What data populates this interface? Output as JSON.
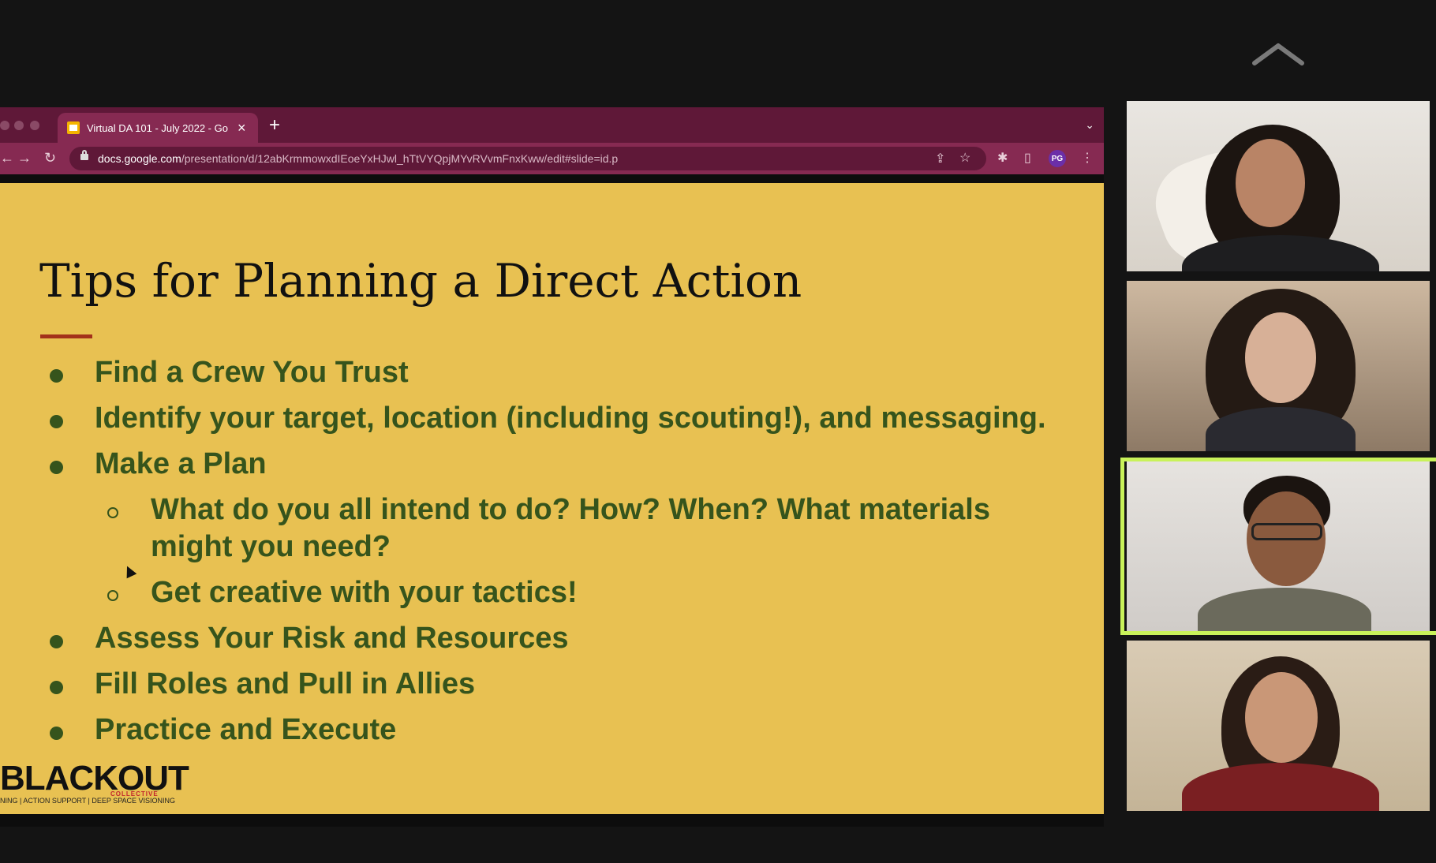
{
  "meeting": {
    "collapse_icon": "chevron-up-icon"
  },
  "browser": {
    "tab_title": "Virtual DA 101 - July 2022 - Go",
    "new_tab_label": "+",
    "url_host": "docs.google.com",
    "url_path": "/presentation/d/12abKrmmowxdIEoeYxHJwl_hTtVYQpjMYvRVvmFnxKww/edit#slide=id.p",
    "profile_initials": "PG",
    "colors": {
      "frame": "#5f1838",
      "toolbar": "#862a52"
    }
  },
  "slide": {
    "title": "Tips for Planning a Direct Action",
    "background": "#e8c152",
    "text_color": "#36541c",
    "bullets": [
      {
        "level": 1,
        "text": "Find a Crew You Trust"
      },
      {
        "level": 1,
        "text": "Identify your target, location (including scouting!), and messaging."
      },
      {
        "level": 1,
        "text": "Make a Plan"
      },
      {
        "level": 2,
        "text": "What do you all intend to do? How? When? What materials",
        "text_cont": "might you need?"
      },
      {
        "level": 2,
        "text": "Get creative with your tactics!"
      },
      {
        "level": 1,
        "text": "Assess Your Risk and Resources"
      },
      {
        "level": 1,
        "text": "Fill Roles and Pull in Allies"
      },
      {
        "level": 1,
        "text": "Practice and Execute"
      }
    ],
    "logo_main": "BLACKOUT",
    "logo_badge": "COLLECTIVE",
    "logo_tagline": "NING | ACTION SUPPORT | DEEP SPACE VISIONING"
  },
  "participants": [
    {
      "id": "participant-1",
      "speaking": false
    },
    {
      "id": "participant-2",
      "speaking": false
    },
    {
      "id": "participant-3",
      "speaking": true,
      "highlight_color": "#c9f25a"
    },
    {
      "id": "participant-4",
      "speaking": false
    }
  ]
}
